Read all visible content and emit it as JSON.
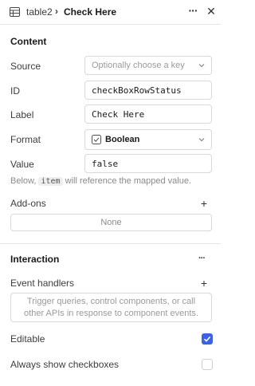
{
  "header": {
    "breadcrumb": "table2",
    "separator": "›",
    "title": "Check Here",
    "more_icon": "more-horizontal-icon",
    "close_icon": "close-icon",
    "table_icon": "table-icon"
  },
  "content": {
    "section_title": "Content",
    "source": {
      "label": "Source",
      "placeholder": "Optionally choose a key"
    },
    "id": {
      "label": "ID",
      "value": "checkBoxRowStatus"
    },
    "label_field": {
      "label": "Label",
      "value": "Check Here"
    },
    "format": {
      "label": "Format",
      "value": "Boolean",
      "icon": "checkbox-format-icon"
    },
    "value_field": {
      "label": "Value",
      "value": "false"
    },
    "hint": {
      "prefix": "Below,",
      "code": "item",
      "suffix": "will reference the mapped value."
    },
    "addons": {
      "label": "Add-ons",
      "empty_text": "None"
    }
  },
  "interaction": {
    "section_title": "Interaction",
    "event_handlers": {
      "label": "Event handlers",
      "empty_text_line1": "Trigger queries, control components, or call",
      "empty_text_line2": "other APIs in response to component events."
    },
    "editable": {
      "label": "Editable",
      "checked": true
    },
    "always_show_checkboxes": {
      "label": "Always show checkboxes",
      "checked": false
    }
  },
  "colors": {
    "accent": "#3d64e0",
    "border": "#d9d9d9",
    "muted_text": "#8a8a8a"
  }
}
